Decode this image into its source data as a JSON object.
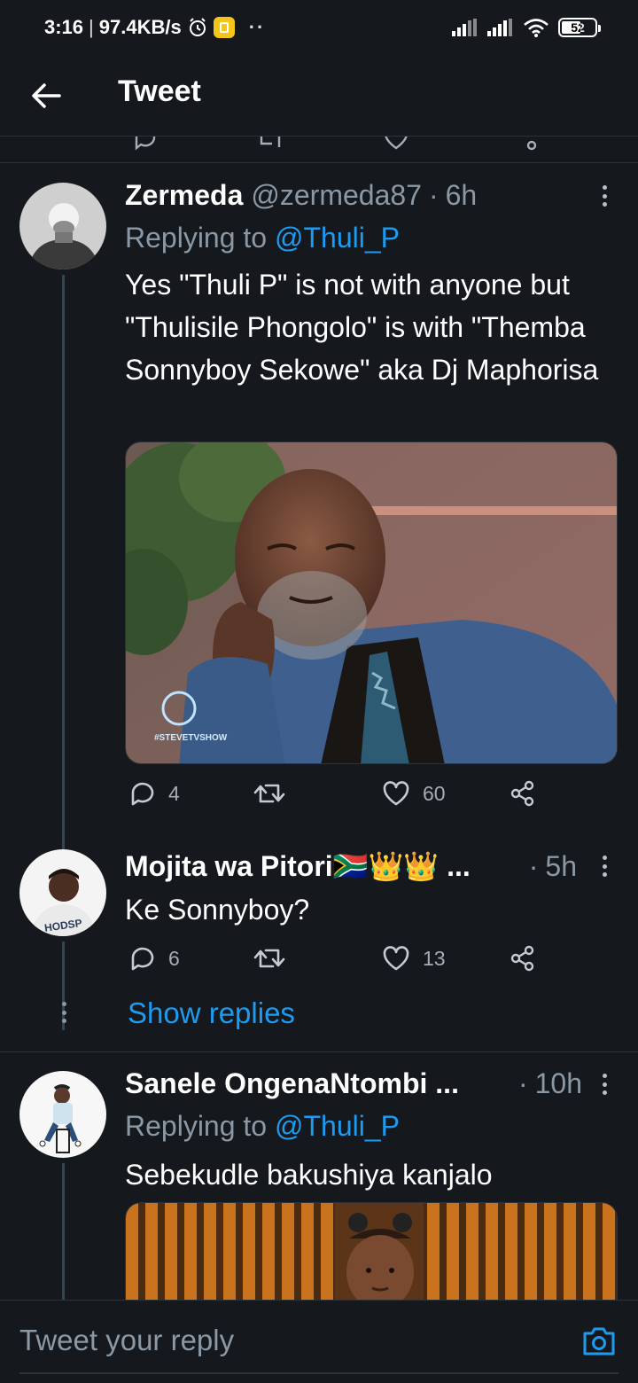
{
  "status_bar": {
    "time": "3:16",
    "separator": "|",
    "speed": "97.4KB/s",
    "more": "··",
    "battery": "52",
    "icons": [
      "alarm-icon",
      "app-notification-icon",
      "signal-icon",
      "signal-icon",
      "wifi-icon",
      "battery-icon"
    ]
  },
  "header": {
    "title": "Tweet",
    "back_icon": "arrow-left-icon"
  },
  "tweets": [
    {
      "name": "Zermeda",
      "handle": "@zermeda87",
      "dot": "·",
      "time": "6h",
      "replying_prefix": "Replying to",
      "replying_to": "@Thuli_P",
      "text": "Yes \"Thuli P\" is not with anyone but \"Thulisile Phongolo\" is with \"Themba Sonnyboy Sekowe\" aka Dj Maphorisa",
      "media": {
        "watermark": "#STEVETVSHOW"
      },
      "stats": {
        "replies": "4",
        "retweets": "",
        "likes": "60"
      }
    },
    {
      "name": "Mojita wa Pitori🇿🇦👑👑 ...",
      "dot": "·",
      "time": "5h",
      "text": "Ke Sonnyboy?",
      "stats": {
        "replies": "6",
        "retweets": "",
        "likes": "13"
      },
      "show_replies": "Show replies"
    },
    {
      "name": "Sanele OngenaNtombi ...",
      "dot": "·",
      "time": "10h",
      "replying_prefix": "Replying to",
      "replying_to": "@Thuli_P",
      "text": "Sebekudle bakushiya kanjalo"
    }
  ],
  "reply_bar": {
    "placeholder": "Tweet your reply",
    "camera_icon": "camera-icon"
  },
  "colors": {
    "background": "#15181c",
    "accent": "#1d9bf0",
    "secondary_text": "#8b98a5",
    "divider": "#2f3336"
  }
}
